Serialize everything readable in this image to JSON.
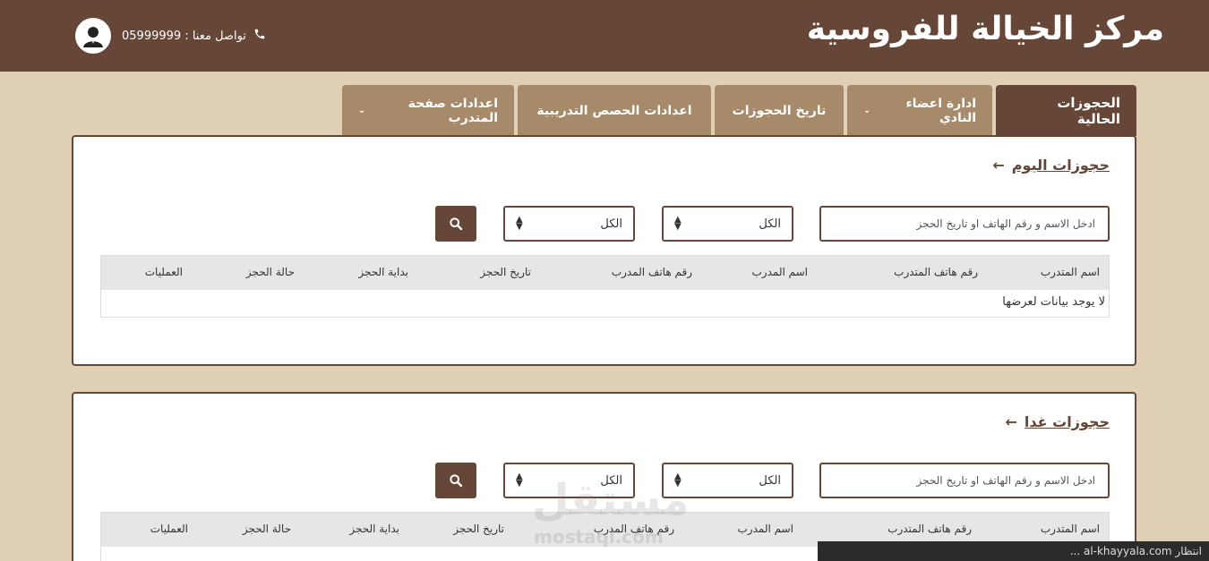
{
  "header": {
    "brand": "مركز الخيالة للفروسية",
    "contact_label": "تواصل معنا : 05999999",
    "icons": {
      "phone": "phone-icon",
      "avatar": "avatar-icon"
    }
  },
  "tabs": [
    {
      "label": "الحجوزات الحالية",
      "active": true,
      "dropdown": false
    },
    {
      "label": "ادارة اعضاء النادي",
      "active": false,
      "dropdown": true
    },
    {
      "label": "تاريخ الحجوزات",
      "active": false,
      "dropdown": false
    },
    {
      "label": "اعدادات الحصص التدريبية",
      "active": false,
      "dropdown": false
    },
    {
      "label": "اعدادات صفحة المتدرب",
      "active": false,
      "dropdown": true
    }
  ],
  "panels": [
    {
      "title": "حجوزات اليوم",
      "search_placeholder": "ادخل الاسم و رقم الهاتف او تاريخ الحجز",
      "select1": "الكل",
      "select2": "الكل",
      "columns": [
        "اسم المتدرب",
        "رقم هاتف المتدرب",
        "اسم المدرب",
        "رقم هاتف المدرب",
        "تاريخ الحجز",
        "بداية الحجز",
        "حالة الحجز",
        "العمليات"
      ],
      "empty_text": "لا يوجد بيانات لعرضها"
    },
    {
      "title": "حجوزات غدا",
      "search_placeholder": "ادخل الاسم و رقم الهاتف او تاريخ الحجز",
      "select1": "الكل",
      "select2": "الكل",
      "columns": [
        "اسم المتدرب",
        "رقم هاتف المتدرب",
        "اسم المدرب",
        "رقم هاتف المدرب",
        "تاريخ الحجز",
        "بداية الحجز",
        "حالة الحجز",
        "العمليات"
      ]
    }
  ],
  "status_bar": "انتظار al-khayyala.com ...",
  "watermark": {
    "text": "مستقل",
    "sub": "mostaql.com"
  },
  "colors": {
    "primary": "#654637",
    "tab": "#a68a6a",
    "background": "#dfcfb4"
  }
}
